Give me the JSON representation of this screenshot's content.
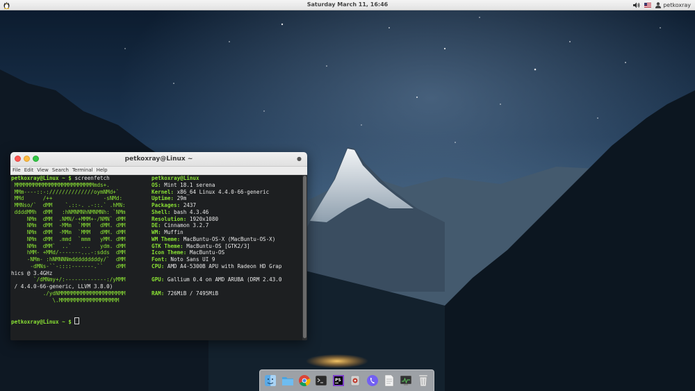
{
  "panel": {
    "clock": "Saturday March 11, 16:46",
    "username": "petkoxray",
    "icons": [
      "tux-icon",
      "volume-icon",
      "us-flag-icon",
      "user-icon"
    ]
  },
  "terminal": {
    "title": "petkoxray@Linux ~",
    "menu": [
      "File",
      "Edit",
      "View",
      "Search",
      "Terminal",
      "Help"
    ],
    "prompt": "petkoxray@Linux ~ $",
    "command": "screenfetch",
    "logo_lines": [
      "",
      " MMMMMMMMMMMMMMMMMMMMMMMMMmds+.",
      " MMm----::-://////////////oymNMd+`",
      " MMd      /++                -sNMd:",
      " MMNso/`  dMM    `.::-. .-::.` .hMN:",
      " ddddMMh  dMM   :hNMNMNhNMNMNh: `NMm",
      "     NMm  dMM  .NMN/-+MMM+-/NMN` dMM",
      "     NMm  dMM  -MMm  `MMM   dMM. dMM",
      "     NMm  dMM  -MMm  `MMM   dMM. dMM",
      "     NMm  dMM  .mmd  `mmm   yMM. dMM",
      "     NMm  dMM`  ..`   ...   ydm. dMM",
      "     hMM- +MMd/-------...-:sdds  dMM",
      "     -NMm- :hNMNNNmdddddddddy/`  dMM",
      "      -dMNs-``-::::-------.``    dMM"
    ],
    "wrap_line_1": "hics @ 3.4GHz",
    "logo_after_wrap": "       `/dMNmy+/:-------------:/yMMM",
    "wrap_line_2": " / 4.4.0-66-generic, LLVM 3.8.0)",
    "logo_tail": [
      "          ./ydNMMMMMMMMMMMMMMMMMMMMM",
      "             \\.MMMMMMMMMMMMMMMMMMM"
    ],
    "info_header": "petkoxray@Linux",
    "info": [
      {
        "key": "OS:",
        "val": " Mint 18.1 serena"
      },
      {
        "key": "Kernel:",
        "val": " x86_64 Linux 4.4.0-66-generic"
      },
      {
        "key": "Uptime:",
        "val": " 29m"
      },
      {
        "key": "Packages:",
        "val": " 2437"
      },
      {
        "key": "Shell:",
        "val": " bash 4.3.46"
      },
      {
        "key": "Resolution:",
        "val": " 1920x1080"
      },
      {
        "key": "DE:",
        "val": " Cinnamon 3.2.7"
      },
      {
        "key": "WM:",
        "val": " Muffin"
      },
      {
        "key": "WM Theme:",
        "val": " MacBuntu-OS-X (MacBuntu-OS-X)"
      },
      {
        "key": "GTK Theme:",
        "val": " MacBuntu-OS [GTK2/3]"
      },
      {
        "key": "Icon Theme:",
        "val": " MacBuntu-OS"
      },
      {
        "key": "Font:",
        "val": " Noto Sans UI 9"
      },
      {
        "key": "CPU:",
        "val": " AMD A4-5300B APU with Radeon HD Grap"
      }
    ],
    "gpu": {
      "key": "GPU:",
      "val": " Gallium 0.4 on AMD ARUBA (DRM 2.43.0"
    },
    "ram": {
      "key": "RAM:",
      "val": " 726MiB / 7495MiB"
    },
    "final_prompt": "petkoxray@Linux ~ $"
  },
  "dock": {
    "items": [
      {
        "name": "finder-icon",
        "color": "#5aa9e6"
      },
      {
        "name": "files-folder-icon",
        "color": "#4aa3df"
      },
      {
        "name": "chrome-icon",
        "color": "#db4437"
      },
      {
        "name": "terminal-icon",
        "color": "#2b2b2b"
      },
      {
        "name": "phpstorm-icon",
        "color": "#7b3fc7"
      },
      {
        "name": "system-tool-icon",
        "color": "#b0b0b0"
      },
      {
        "name": "viber-icon",
        "color": "#7360f2"
      },
      {
        "name": "text-editor-icon",
        "color": "#e6e6e6"
      },
      {
        "name": "system-monitor-icon",
        "color": "#333333"
      },
      {
        "name": "trash-icon",
        "color": "#d8d8d8"
      }
    ]
  }
}
